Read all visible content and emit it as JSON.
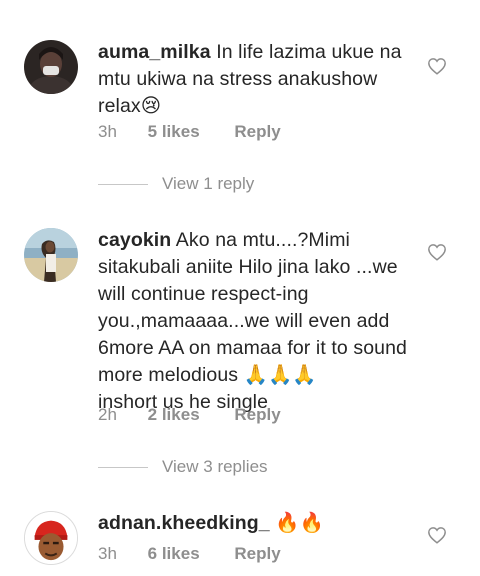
{
  "comments": [
    {
      "username": "auma_milka",
      "text": "In life lazima ukue na mtu ukiwa na stress anakushow relax",
      "emoji": "😢",
      "time": "3h",
      "likes": "5 likes",
      "reply": "Reply",
      "view_replies": "View 1 reply"
    },
    {
      "username": "cayokin",
      "text": "Ako na mtu....?Mimi sitakubali aniite Hilo jina lako ...we will continue respect-ing  you.,mamaaaa...we will even add 6more AA on mamaa for it to sound more melodious",
      "emoji": "🙏🙏🙏",
      "text2": "inshort us he single",
      "time": "2h",
      "likes": "2 likes",
      "reply": "Reply",
      "view_replies": "View 3 replies"
    },
    {
      "username": "adnan.kheedking_",
      "text": "",
      "emoji": "🔥🔥",
      "time": "3h",
      "likes": "6 likes",
      "reply": "Reply"
    }
  ],
  "icons": {
    "like": "heart-outline-icon"
  }
}
